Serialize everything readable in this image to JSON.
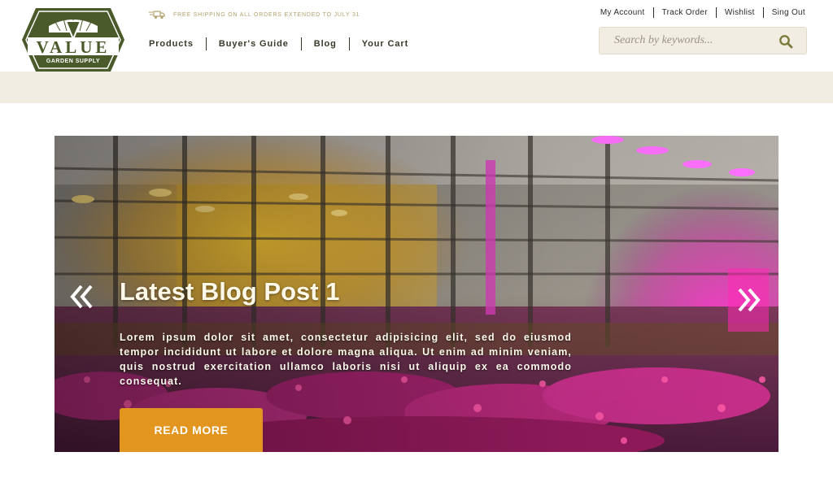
{
  "brand": {
    "name": "VALUE",
    "tagline": "GARDEN SUPPLY",
    "colors": {
      "logo": "#4a5a2a",
      "accent": "#e2961f",
      "band": "#f1ede2"
    }
  },
  "promo": {
    "icon": "delivery-truck-icon",
    "text": "FREE SHIPPING ON ALL ORDERS EXTENDED TO JULY 31"
  },
  "nav": {
    "items": [
      {
        "label": "Products"
      },
      {
        "label": "Buyer's Guide"
      },
      {
        "label": "Blog"
      },
      {
        "label": "Your Cart"
      }
    ]
  },
  "account_links": [
    {
      "label": "My Account"
    },
    {
      "label": "Track Order"
    },
    {
      "label": "Wishlist"
    },
    {
      "label": "Sing Out"
    }
  ],
  "search": {
    "placeholder": "Search by keywords...",
    "icon": "search-icon"
  },
  "hero": {
    "title": "Latest Blog Post 1",
    "text": "Lorem ipsum dolor sit amet, consectetur adipisicing elit, sed do eiusmod tempor incididunt ut labore et dolore magna aliqua. Ut enim ad minim veniam, quis nostrud exercitation ullamco laboris nisi ut aliquip ex ea commodo consequat.",
    "button": "READ MORE",
    "prev_icon": "double-chevron-left-icon",
    "next_icon": "double-chevron-right-icon"
  }
}
